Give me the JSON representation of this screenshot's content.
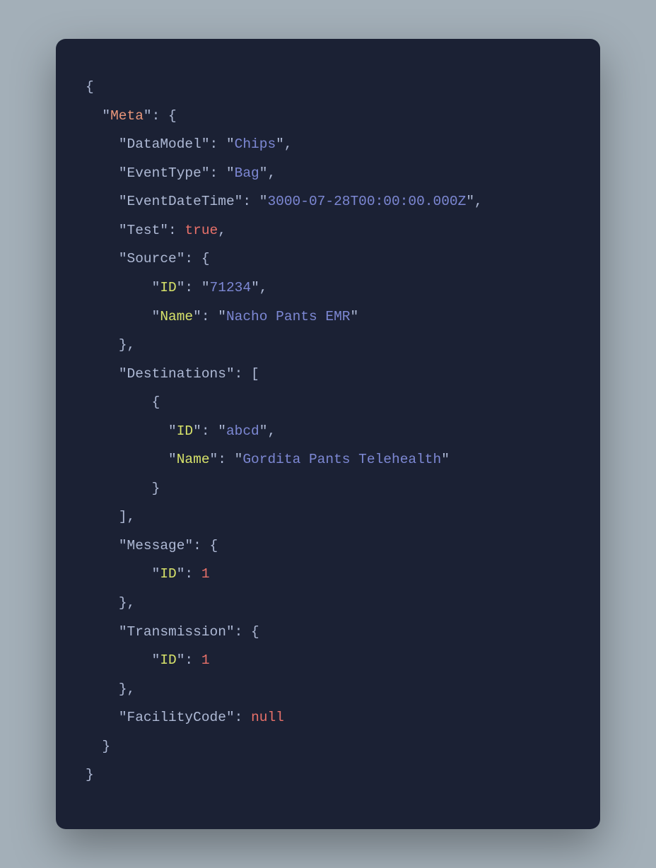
{
  "code": {
    "meta_key": "Meta",
    "datamodel_key": "DataModel",
    "datamodel_val": "Chips",
    "eventtype_key": "EventType",
    "eventtype_val": "Bag",
    "eventdatetime_key": "EventDateTime",
    "eventdatetime_val": "3000-07-28T00:00:00.000Z",
    "test_key": "Test",
    "test_val": "true",
    "source_key": "Source",
    "source_id_key": "ID",
    "source_id_val": "71234",
    "source_name_key": "Name",
    "source_name_val": "Nacho Pants EMR",
    "destinations_key": "Destinations",
    "dest_id_key": "ID",
    "dest_id_val": "abcd",
    "dest_name_key": "Name",
    "dest_name_val": "Gordita Pants Telehealth",
    "message_key": "Message",
    "message_id_key": "ID",
    "message_id_val": "1",
    "transmission_key": "Transmission",
    "transmission_id_key": "ID",
    "transmission_id_val": "1",
    "facilitycode_key": "FacilityCode",
    "facilitycode_val": "null"
  }
}
